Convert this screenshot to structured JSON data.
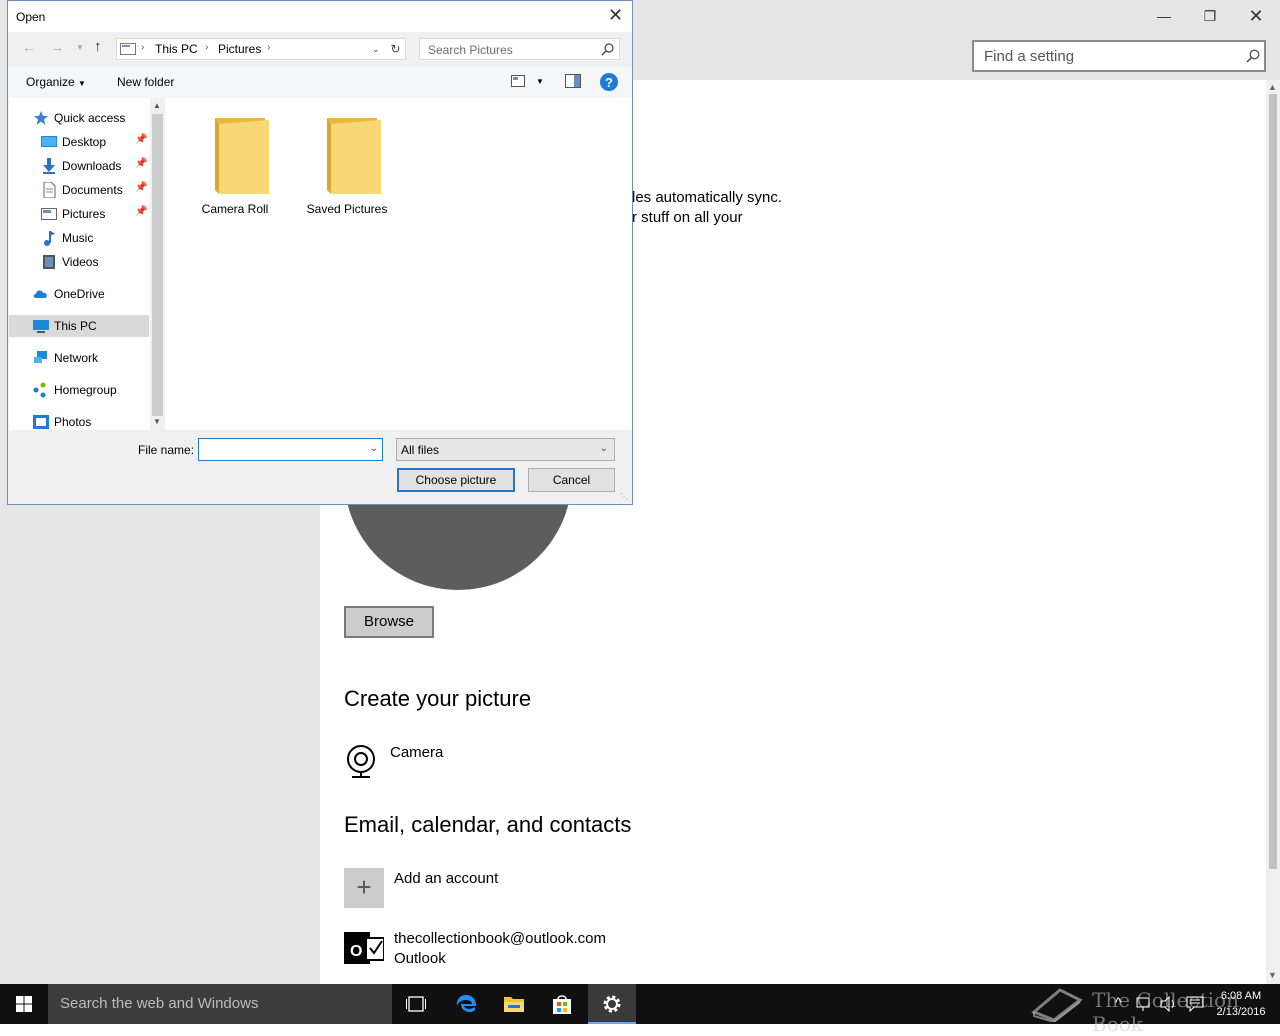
{
  "settings": {
    "find_placeholder": "Find a setting",
    "sync_line1": "les automatically sync.",
    "sync_line2": "r stuff on all your",
    "browse_label": "Browse",
    "create_heading": "Create your picture",
    "camera_label": "Camera",
    "email_heading": "Email, calendar, and contacts",
    "add_account_label": "Add an account",
    "account_email": "thecollectionbook@outlook.com",
    "account_type": "Outlook"
  },
  "dialog": {
    "title": "Open",
    "breadcrumb": [
      "This PC",
      "Pictures"
    ],
    "search_placeholder": "Search Pictures",
    "organize_label": "Organize",
    "new_folder_label": "New folder",
    "nav_items": [
      {
        "label": "Quick access",
        "icon": "star-icon"
      },
      {
        "label": "Desktop",
        "icon": "desktop-icon",
        "pinned": true
      },
      {
        "label": "Downloads",
        "icon": "download-icon",
        "pinned": true
      },
      {
        "label": "Documents",
        "icon": "document-icon",
        "pinned": true
      },
      {
        "label": "Pictures",
        "icon": "pictures-icon",
        "pinned": true
      },
      {
        "label": "Music",
        "icon": "music-icon"
      },
      {
        "label": "Videos",
        "icon": "video-icon"
      },
      {
        "label": "OneDrive",
        "icon": "cloud-icon"
      },
      {
        "label": "This PC",
        "icon": "computer-icon",
        "selected": true
      },
      {
        "label": "Network",
        "icon": "network-icon"
      },
      {
        "label": "Homegroup",
        "icon": "homegroup-icon"
      },
      {
        "label": "Photos",
        "icon": "photos-icon"
      }
    ],
    "folders": [
      "Camera Roll",
      "Saved Pictures"
    ],
    "file_name_label": "File name:",
    "file_name_value": "",
    "file_type_value": "All files",
    "choose_label": "Choose picture",
    "cancel_label": "Cancel"
  },
  "taskbar": {
    "search_placeholder": "Search the web and Windows",
    "time": "6:08 AM",
    "date": "2/13/2016",
    "watermark": "The Collection Book"
  },
  "colors": {
    "accent": "#2a74cb",
    "folder": "#f8d775",
    "taskbar": "#101010"
  }
}
